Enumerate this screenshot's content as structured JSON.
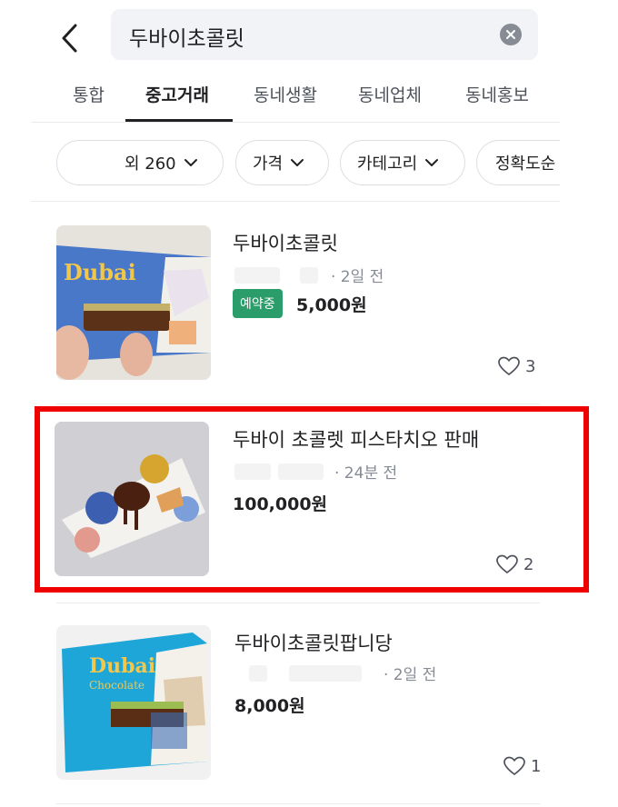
{
  "search": {
    "query": "두바이초콜릿",
    "back_icon": "chevron-left-icon",
    "clear_icon": "close-circle-icon"
  },
  "tabs": [
    {
      "label": "통합",
      "active": false
    },
    {
      "label": "중고거래",
      "active": true
    },
    {
      "label": "동네생활",
      "active": false
    },
    {
      "label": "동네업체",
      "active": false
    },
    {
      "label": "동네홍보",
      "active": false
    }
  ],
  "filters": [
    {
      "label": "외 260"
    },
    {
      "label": "가격"
    },
    {
      "label": "카테고리"
    },
    {
      "label": "정확도순"
    }
  ],
  "listings": [
    {
      "title": "두바이초콜릿",
      "time": "· 2일 전",
      "badge": "예약중",
      "price": "5,000원",
      "likes": "3"
    },
    {
      "title": "두바이 초콜렛 피스타치오 판매",
      "time": "· 24분 전",
      "price": "100,000원",
      "likes": "2"
    },
    {
      "title": "두바이초콜릿팝니당",
      "time": "· 2일 전",
      "price": "8,000원",
      "likes": "1"
    }
  ],
  "product_art": {
    "brand": "Dubai",
    "brand_sub": "Chocolate"
  },
  "colors": {
    "highlight": "#ee0000",
    "badge": "#2a9d6b",
    "search_bg": "#f2f3f6"
  }
}
